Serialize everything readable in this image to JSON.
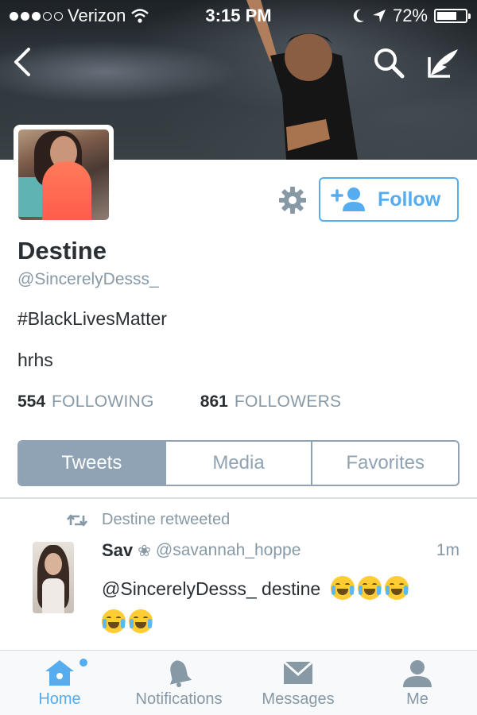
{
  "status_bar": {
    "carrier": "Verizon",
    "time": "3:15 PM",
    "battery": "72%",
    "battery_level": 0.72,
    "signal_bars_filled": 3,
    "signal_bars_total": 5
  },
  "header": {
    "back_icon": "chevron-left-icon",
    "search_icon": "search-icon",
    "compose_icon": "compose-icon"
  },
  "profile": {
    "name": "Destine",
    "handle": "@SincerelyDesss_",
    "bio_line1": "#BlackLivesMatter",
    "bio_line2": "hrhs",
    "following_count": "554",
    "following_label": "FOLLOWING",
    "followers_count": "861",
    "followers_label": "FOLLOWERS",
    "follow_button": "Follow"
  },
  "tabs": [
    {
      "label": "Tweets",
      "active": true
    },
    {
      "label": "Media",
      "active": false
    },
    {
      "label": "Favorites",
      "active": false
    }
  ],
  "tweet": {
    "retweet_label": "Destine retweeted",
    "author_name": "Sav",
    "author_symbol": "❀",
    "author_handle": "@savannah_hoppe",
    "time": "1m",
    "text": "@SincerelyDesss_ destine"
  },
  "bottom_nav": [
    {
      "label": "Home",
      "icon": "home-icon",
      "active": true
    },
    {
      "label": "Notifications",
      "icon": "bell-icon",
      "active": false
    },
    {
      "label": "Messages",
      "icon": "envelope-icon",
      "active": false
    },
    {
      "label": "Me",
      "icon": "person-icon",
      "active": false
    }
  ],
  "colors": {
    "accent": "#55acee",
    "muted": "#8899a6",
    "tab_active": "#8fa3b4",
    "text": "#292f33"
  }
}
